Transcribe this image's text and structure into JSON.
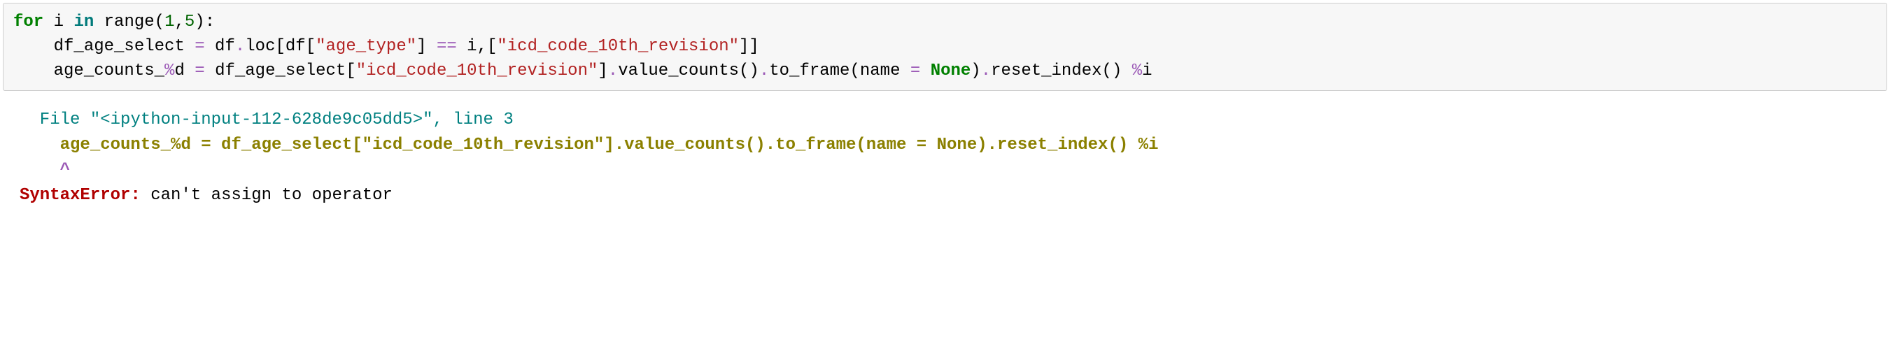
{
  "code": {
    "line1": {
      "kw_for": "for",
      "var_i": " i ",
      "kw_in": "in",
      "range": " range",
      "open_paren": "(",
      "num1": "1",
      "comma": ",",
      "num5": "5",
      "close_paren_colon": "):"
    },
    "line2": {
      "indent": "    ",
      "var_lhs": "df_age_select ",
      "op_eq": "=",
      "var_df": " df",
      "dot_loc": ".",
      "loc": "loc[df[",
      "str_age": "\"age_type\"",
      "bracket_close": "] ",
      "op_eqeq": "==",
      "var_i": " i,[",
      "str_icd": "\"icd_code_10th_revision\"",
      "close": "]]"
    },
    "line3": {
      "indent": "    ",
      "var_lhs1": "age_counts_",
      "op_mod": "%",
      "var_d": "d ",
      "op_eq": "=",
      "var_rhs": " df_age_select[",
      "str_icd": "\"icd_code_10th_revision\"",
      "bracket_close": "]",
      "dot1": ".",
      "value_counts": "value_counts()",
      "dot2": ".",
      "to_frame": "to_frame(name ",
      "op_eq2": "=",
      "space": " ",
      "none": "None",
      "paren_close": ")",
      "dot3": ".",
      "reset_index": "reset_index() ",
      "op_mod2": "%",
      "var_i_end": "i"
    }
  },
  "error": {
    "file_prefix": "  File ",
    "file_str": "\"<ipython-input-112-628de9c05dd5>\"",
    "file_suffix": ", line ",
    "line_num": "3",
    "err_line": "    age_counts_%d = df_age_select[\"icd_code_10th_revision\"].value_counts().to_frame(name = None).reset_index() %i",
    "caret": "    ^",
    "label": "SyntaxError",
    "colon": ":",
    "msg": " can't assign to operator"
  }
}
